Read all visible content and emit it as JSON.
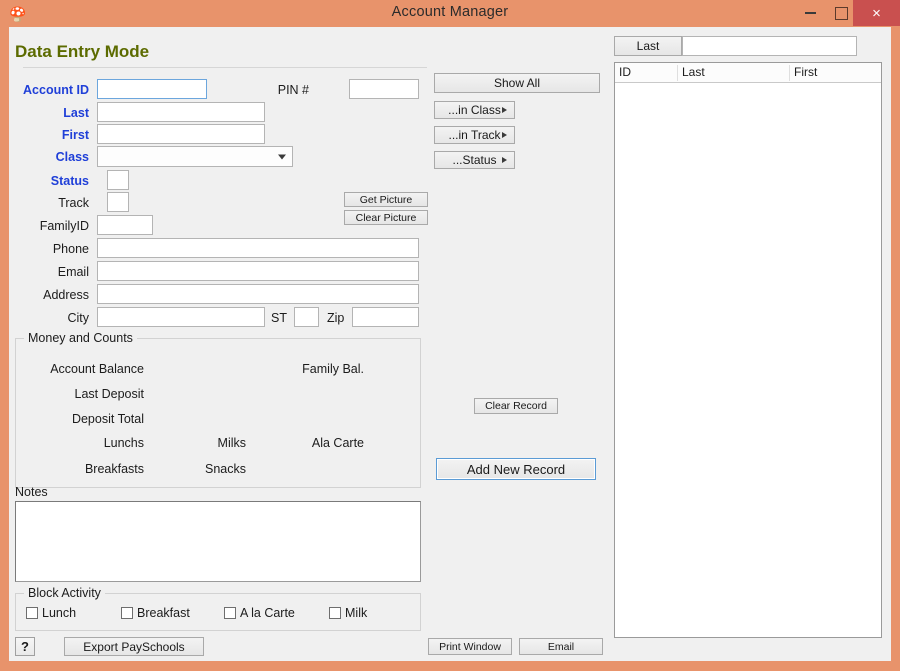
{
  "window": {
    "title": "Account Manager",
    "icon": "app-icon",
    "minimize_label": "minimize-icon",
    "maximize_label": "maximize-icon",
    "close_label": "×",
    "titlebar_color": "#e8936b",
    "close_button_color": "#c9504f"
  },
  "header": {
    "mode_title": "Data Entry Mode",
    "mode_title_color": "#5c6b00"
  },
  "form": {
    "account_id": {
      "label": "Account ID",
      "value": "",
      "focused": true
    },
    "pin": {
      "label": "PIN #",
      "value": ""
    },
    "last": {
      "label": "Last",
      "value": ""
    },
    "first": {
      "label": "First",
      "value": ""
    },
    "class": {
      "label": "Class",
      "value": "",
      "options": []
    },
    "status": {
      "label": "Status",
      "value": ""
    },
    "track": {
      "label": "Track",
      "value": ""
    },
    "family_id": {
      "label": "FamilyID",
      "value": ""
    },
    "phone": {
      "label": "Phone",
      "value": ""
    },
    "email": {
      "label": "Email",
      "value": ""
    },
    "address": {
      "label": "Address",
      "value": ""
    },
    "city": {
      "label": "City",
      "value": ""
    },
    "state": {
      "label": "ST",
      "value": ""
    },
    "zip": {
      "label": "Zip",
      "value": ""
    }
  },
  "picture": {
    "get_label": "Get Picture",
    "clear_label": "Clear Picture"
  },
  "money": {
    "group_title": "Money and Counts",
    "account_balance_label": "Account Balance",
    "account_balance_value": "",
    "family_bal_label": "Family Bal.",
    "family_bal_value": "",
    "last_deposit_label": "Last Deposit",
    "last_deposit_value": "",
    "deposit_total_label": "Deposit Total",
    "deposit_total_value": "",
    "lunchs_label": "Lunchs",
    "lunchs_value": "",
    "milks_label": "Milks",
    "milks_value": "",
    "ala_carte_label": "Ala Carte",
    "ala_carte_value": "",
    "breakfasts_label": "Breakfasts",
    "breakfasts_value": "",
    "snacks_label": "Snacks",
    "snacks_value": ""
  },
  "notes": {
    "label": "Notes",
    "value": ""
  },
  "block_activity": {
    "group_title": "Block Activity",
    "items": [
      {
        "label": "Lunch",
        "checked": false
      },
      {
        "label": "Breakfast",
        "checked": false
      },
      {
        "label": "A la Carte",
        "checked": false
      },
      {
        "label": "Milk",
        "checked": false
      }
    ]
  },
  "filters": {
    "show_all": "Show All",
    "in_class": "...in Class",
    "in_track": "...in Track",
    "status": "...Status"
  },
  "actions": {
    "clear_record": "Clear Record",
    "add_new_record": "Add New Record",
    "export_payschools": "Export PaySchools",
    "help": "?",
    "print_window": "Print Window",
    "email": "Email"
  },
  "search": {
    "button_label": "Last",
    "value": "",
    "placeholder": ""
  },
  "list": {
    "columns": [
      "ID",
      "Last",
      "First"
    ],
    "rows": []
  }
}
